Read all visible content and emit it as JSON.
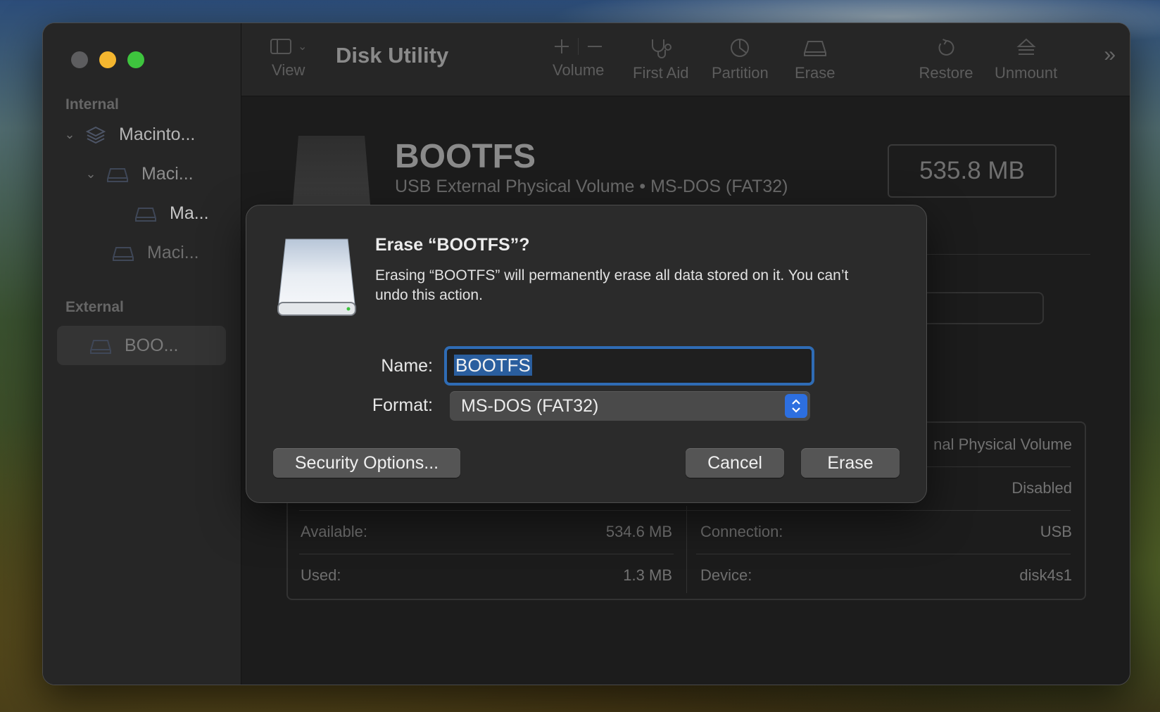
{
  "window": {
    "title": "Disk Utility"
  },
  "toolbar": {
    "view_label": "View",
    "volume_label": "Volume",
    "first_aid_label": "First Aid",
    "partition_label": "Partition",
    "erase_label": "Erase",
    "restore_label": "Restore",
    "unmount_label": "Unmount"
  },
  "sidebar": {
    "internal_header": "Internal",
    "external_header": "External",
    "items": [
      {
        "label": "Macinto..."
      },
      {
        "label": "Maci..."
      },
      {
        "label": "Ma..."
      },
      {
        "label": "Maci..."
      },
      {
        "label": "BOO..."
      }
    ]
  },
  "volume": {
    "name": "BOOTFS",
    "subtitle": "USB External Physical Volume • MS-DOS (FAT32)",
    "size": "535.8 MB"
  },
  "info": {
    "type_partial": "nal Physical Volume",
    "owners_value": "Disabled",
    "available_label": "Available:",
    "available_value": "534.6 MB",
    "used_label": "Used:",
    "used_value": "1.3 MB",
    "connection_label": "Connection:",
    "connection_value": "USB",
    "device_label": "Device:",
    "device_value": "disk4s1"
  },
  "dialog": {
    "title": "Erase “BOOTFS”?",
    "message": "Erasing “BOOTFS” will permanently erase all data stored on it. You can’t undo this action.",
    "name_label": "Name:",
    "name_value": "BOOTFS",
    "format_label": "Format:",
    "format_value": "MS-DOS (FAT32)",
    "security_button": "Security Options...",
    "cancel_button": "Cancel",
    "erase_button": "Erase"
  },
  "colors": {
    "accent": "#2f6cb5",
    "close": "#5d5d5f",
    "minimize": "#f4b62f",
    "zoom": "#3ec43e"
  }
}
